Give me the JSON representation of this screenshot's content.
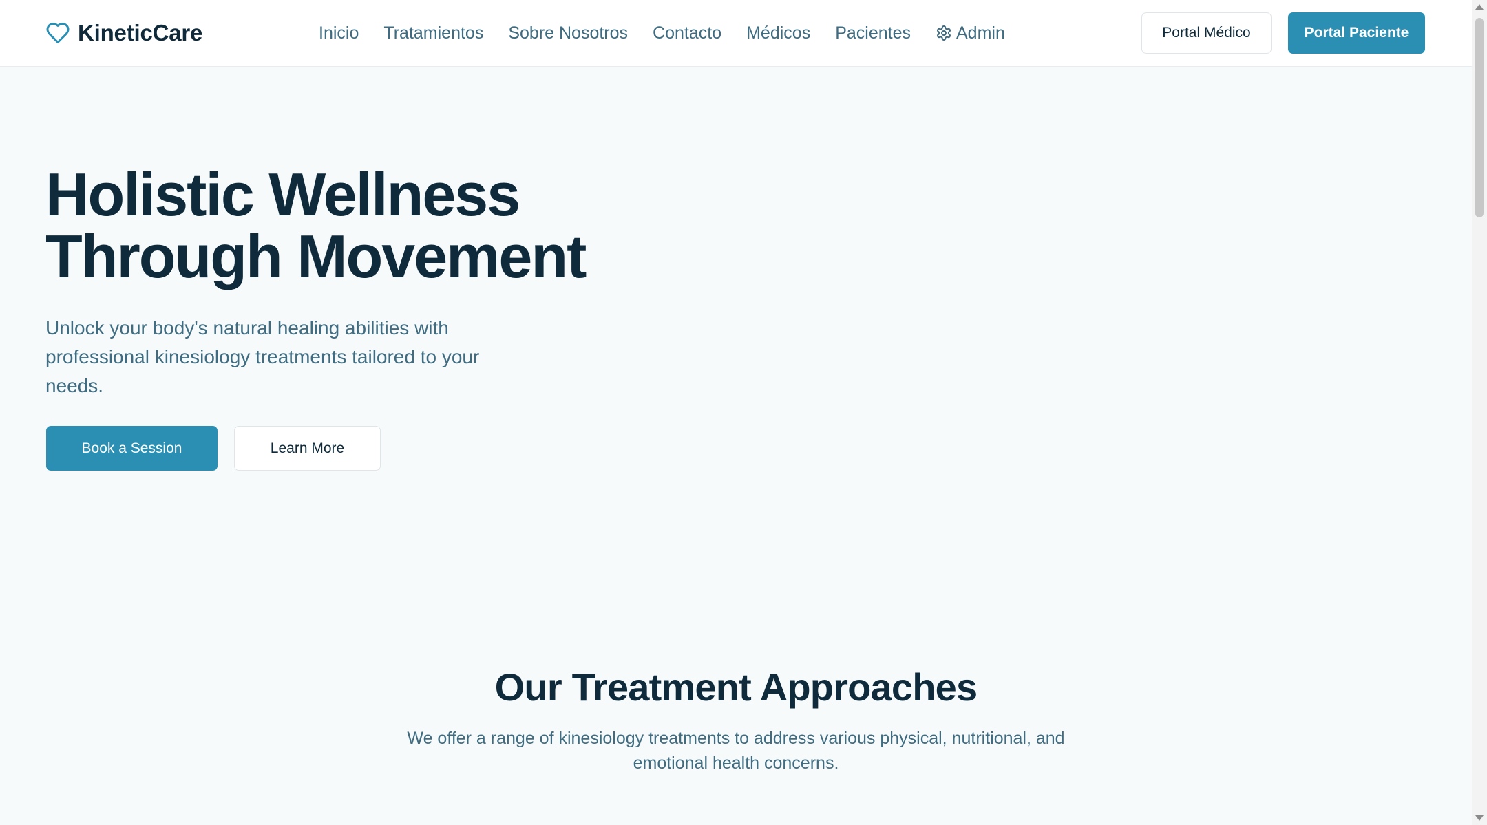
{
  "brand": {
    "name": "KineticCare",
    "icon": "heart-icon",
    "color": "#2b8fb3"
  },
  "nav": {
    "items": [
      {
        "label": "Inicio"
      },
      {
        "label": "Tratamientos"
      },
      {
        "label": "Sobre Nosotros"
      },
      {
        "label": "Contacto"
      },
      {
        "label": "Médicos"
      },
      {
        "label": "Pacientes"
      },
      {
        "label": "Admin",
        "icon": "gear-icon"
      }
    ]
  },
  "header_buttons": {
    "medico": "Portal Médico",
    "paciente": "Portal Paciente"
  },
  "hero": {
    "title_line1": "Holistic Wellness",
    "title_line2": "Through Movement",
    "subtitle": "Unlock your body's natural healing abilities with professional kinesiology treatments tailored to your needs.",
    "primary_button": "Book a Session",
    "secondary_button": "Learn More"
  },
  "treatments": {
    "title": "Our Treatment Approaches",
    "subtitle": "We offer a range of kinesiology treatments to address various physical, nutritional, and emotional health concerns."
  },
  "colors": {
    "accent": "#2b8fb3",
    "text_dark": "#0f2a3a",
    "text_muted": "#3f6c80",
    "background": "#f6fafb"
  }
}
